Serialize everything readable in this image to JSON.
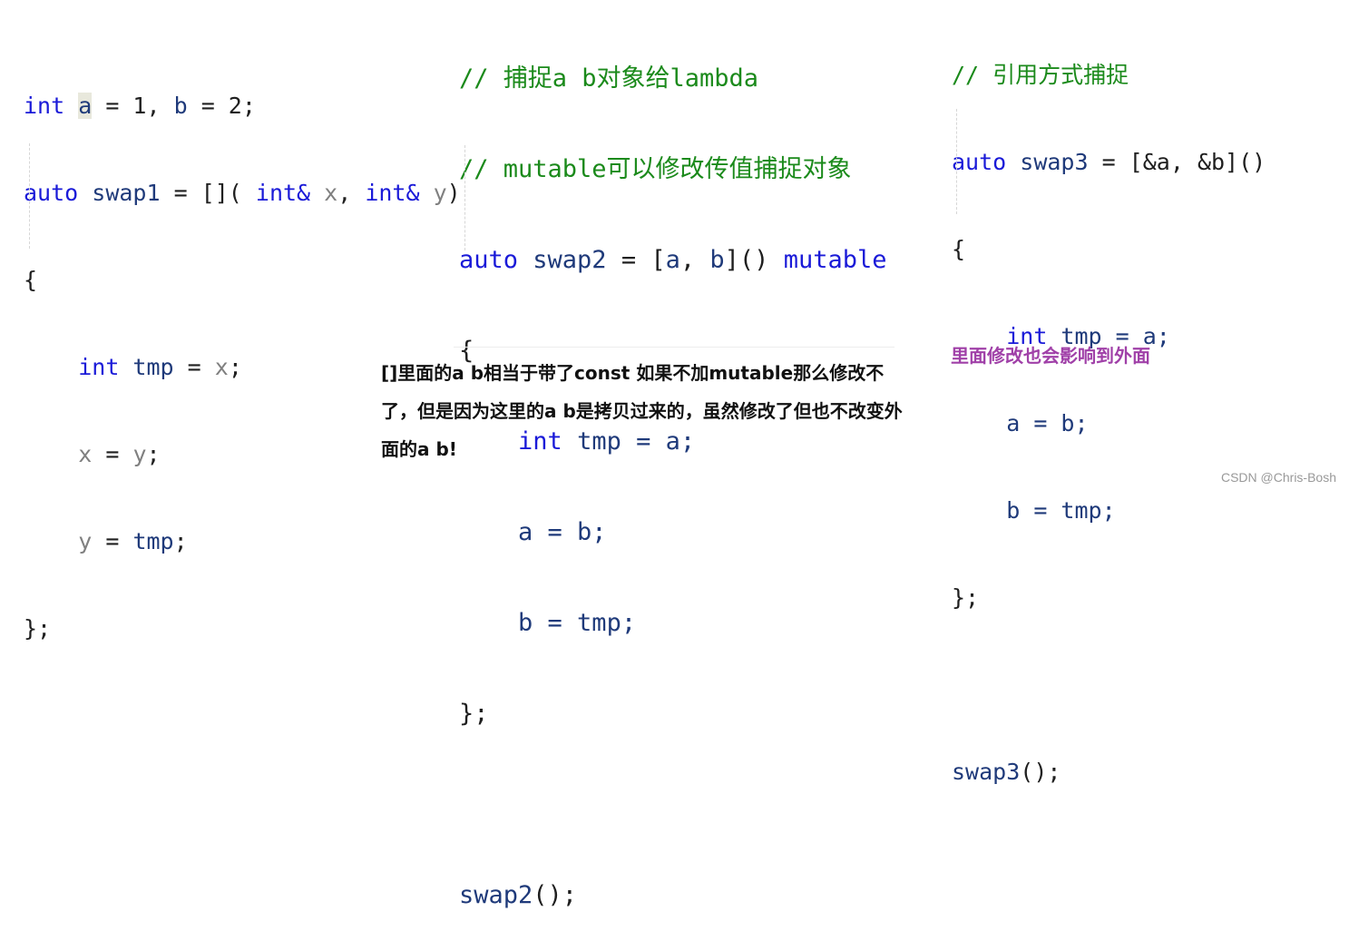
{
  "panel1": {
    "lines": [
      {
        "t1": "int",
        "t2": "a",
        "t3": " = 1, ",
        "t4": "b",
        "t5": " = 2;"
      },
      {
        "t1": "auto",
        "t2": " swap1",
        "t3": " = []( ",
        "t4": "int&",
        "t5": " x",
        "t6": ", ",
        "t7": "int&",
        "t8": " y",
        "t9": ")"
      },
      {
        "text": "{"
      },
      {
        "t1": "int",
        "t2": " tmp",
        "t3": " = ",
        "t4": "x",
        "t5": ";"
      },
      {
        "t1": "x",
        "t2": " = ",
        "t3": "y",
        "t4": ";"
      },
      {
        "t1": "y",
        "t2": " = ",
        "t3": "tmp",
        "t4": ";"
      },
      {
        "text": "};"
      }
    ]
  },
  "panel2": {
    "comments": [
      "// 捕捉a b对象给lambda",
      "// mutable可以修改传值捕捉对象"
    ],
    "decl": {
      "kw": "auto",
      "name": " swap2",
      "eq": " = [",
      "cap1": "a",
      "sep": ", ",
      "cap2": "b",
      "close": "]() ",
      "mod": "mutable"
    },
    "open_brace": "{",
    "body": [
      {
        "kw": "int",
        "rest": " tmp = a;"
      },
      {
        "rest": "a = b;"
      },
      {
        "rest": "b = tmp;"
      }
    ],
    "close_brace": "};",
    "call": {
      "name": "swap2",
      "tail": "();"
    }
  },
  "panel3": {
    "comment": "// 引用方式捕捉",
    "decl": {
      "kw": "auto",
      "name": " swap3",
      "rest": " = [&a, &b]()"
    },
    "open_brace": "{",
    "body": [
      {
        "kw": "int",
        "rest": " tmp = a;"
      },
      {
        "rest": "a = b;"
      },
      {
        "rest": "b = tmp;"
      }
    ],
    "close_brace": "};",
    "call": {
      "name": "swap3",
      "tail": "();"
    }
  },
  "notes": {
    "mutable_explanation": "[]里面的a b相当于带了const 如果不加mutable那么修改不了，但是因为这里的a b是拷贝过来的，虽然修改了但也不改变外面的a b!",
    "reference_explanation": "里面修改也会影响到外面"
  },
  "watermark": "CSDN @Chris-Bosh"
}
